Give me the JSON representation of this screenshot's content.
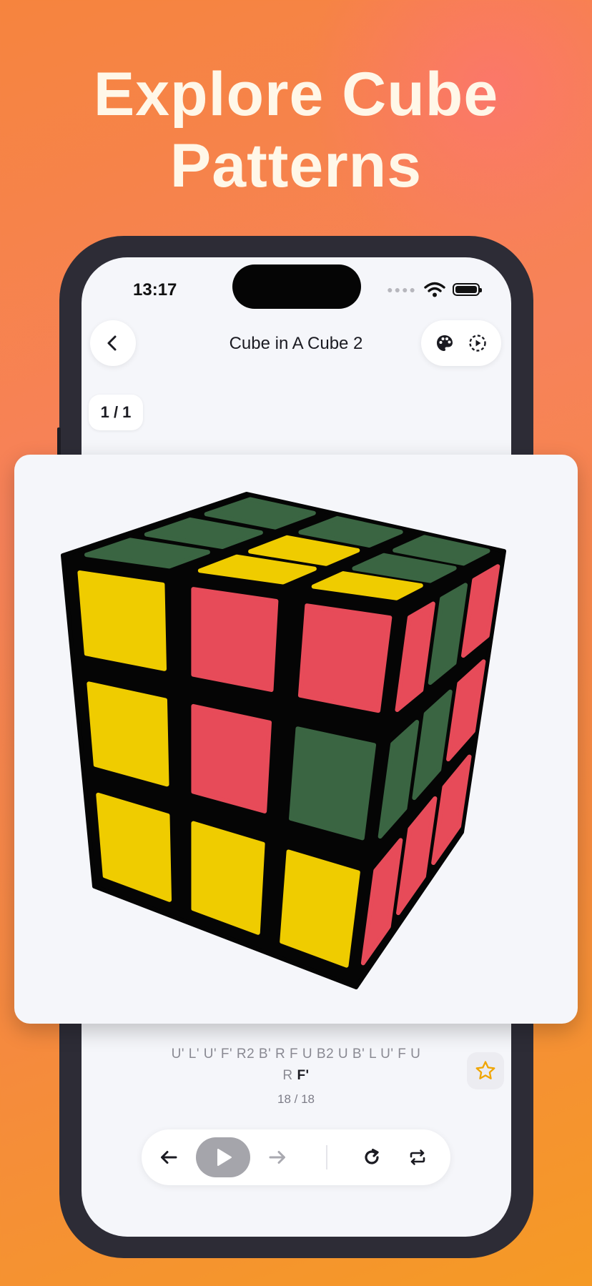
{
  "headline": {
    "line1": "Explore Cube",
    "line2": "Patterns"
  },
  "status_bar": {
    "time": "13:17"
  },
  "nav": {
    "title": "Cube in A Cube 2",
    "back_icon": "chevron-left-icon",
    "palette_icon": "palette-icon",
    "autoplay_icon": "play-circle-icon"
  },
  "page_indicator": "1 / 1",
  "cube": {
    "colors": {
      "green": "#3a6542",
      "yellow": "#efcc00",
      "red": "#e74b59",
      "body": "#050505"
    },
    "top_face": [
      [
        "green",
        "green",
        "green"
      ],
      [
        "green",
        "yellow",
        "green"
      ],
      [
        "green",
        "yellow",
        "yellow"
      ]
    ],
    "front_face": [
      [
        "yellow",
        "red",
        "red"
      ],
      [
        "yellow",
        "red",
        "green"
      ],
      [
        "yellow",
        "yellow",
        "yellow"
      ]
    ],
    "right_face": [
      [
        "red",
        "green",
        "red"
      ],
      [
        "green",
        "green",
        "red"
      ],
      [
        "red",
        "red",
        "red"
      ]
    ]
  },
  "algorithm": {
    "line1": "U' L' U' F' R2 B' R F U B2 U B' L U' F U",
    "line2_prefix": "R",
    "current_move": "F'",
    "counter": "18 / 18"
  },
  "accent": "#f0a500",
  "controls": {
    "prev_icon": "arrow-left-icon",
    "play_icon": "play-icon",
    "next_icon": "arrow-right-icon",
    "reset_icon": "rotate-icon",
    "loop_icon": "repeat-icon"
  }
}
